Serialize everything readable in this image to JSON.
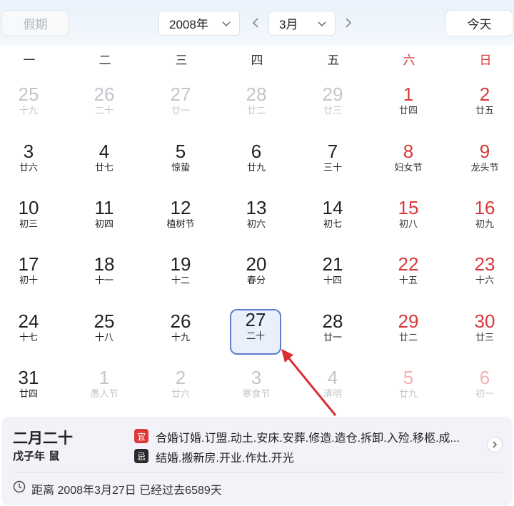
{
  "header": {
    "holiday_label": "假期",
    "year_value": "2008年",
    "month_value": "3月",
    "today_label": "今天"
  },
  "weekdays": [
    "一",
    "二",
    "三",
    "四",
    "五",
    "六",
    "日"
  ],
  "days": [
    {
      "num": "25",
      "lunar": "十九",
      "style": "dim"
    },
    {
      "num": "26",
      "lunar": "二十",
      "style": "dim"
    },
    {
      "num": "27",
      "lunar": "廿一",
      "style": "dim"
    },
    {
      "num": "28",
      "lunar": "廿二",
      "style": "dim"
    },
    {
      "num": "29",
      "lunar": "廿三",
      "style": "dim"
    },
    {
      "num": "1",
      "lunar": "廿四",
      "style": "red"
    },
    {
      "num": "2",
      "lunar": "廿五",
      "style": "red"
    },
    {
      "num": "3",
      "lunar": "廿六",
      "style": "normal"
    },
    {
      "num": "4",
      "lunar": "廿七",
      "style": "normal"
    },
    {
      "num": "5",
      "lunar": "惊蛰",
      "style": "normal"
    },
    {
      "num": "6",
      "lunar": "廿九",
      "style": "normal"
    },
    {
      "num": "7",
      "lunar": "三十",
      "style": "normal"
    },
    {
      "num": "8",
      "lunar": "妇女节",
      "style": "red"
    },
    {
      "num": "9",
      "lunar": "龙头节",
      "style": "red"
    },
    {
      "num": "10",
      "lunar": "初三",
      "style": "normal"
    },
    {
      "num": "11",
      "lunar": "初四",
      "style": "normal"
    },
    {
      "num": "12",
      "lunar": "植树节",
      "style": "normal"
    },
    {
      "num": "13",
      "lunar": "初六",
      "style": "normal"
    },
    {
      "num": "14",
      "lunar": "初七",
      "style": "normal"
    },
    {
      "num": "15",
      "lunar": "初八",
      "style": "red"
    },
    {
      "num": "16",
      "lunar": "初九",
      "style": "red"
    },
    {
      "num": "17",
      "lunar": "初十",
      "style": "normal"
    },
    {
      "num": "18",
      "lunar": "十一",
      "style": "normal"
    },
    {
      "num": "19",
      "lunar": "十二",
      "style": "normal"
    },
    {
      "num": "20",
      "lunar": "春分",
      "style": "normal"
    },
    {
      "num": "21",
      "lunar": "十四",
      "style": "normal"
    },
    {
      "num": "22",
      "lunar": "十五",
      "style": "red"
    },
    {
      "num": "23",
      "lunar": "十六",
      "style": "red"
    },
    {
      "num": "24",
      "lunar": "十七",
      "style": "normal"
    },
    {
      "num": "25",
      "lunar": "十八",
      "style": "normal"
    },
    {
      "num": "26",
      "lunar": "十九",
      "style": "normal"
    },
    {
      "num": "27",
      "lunar": "二十",
      "style": "selected"
    },
    {
      "num": "28",
      "lunar": "廿一",
      "style": "normal"
    },
    {
      "num": "29",
      "lunar": "廿二",
      "style": "red"
    },
    {
      "num": "30",
      "lunar": "廿三",
      "style": "red"
    },
    {
      "num": "31",
      "lunar": "廿四",
      "style": "normal"
    },
    {
      "num": "1",
      "lunar": "愚人节",
      "style": "dim"
    },
    {
      "num": "2",
      "lunar": "廿六",
      "style": "dim"
    },
    {
      "num": "3",
      "lunar": "寒食节",
      "style": "dim"
    },
    {
      "num": "4",
      "lunar": "清明",
      "style": "dim"
    },
    {
      "num": "5",
      "lunar": "廿九",
      "style": "dimred"
    },
    {
      "num": "6",
      "lunar": "初一",
      "style": "dimred"
    }
  ],
  "info": {
    "lunar_date": "二月二十",
    "ganzhi": "戊子年 鼠",
    "yi_tag": "宜",
    "yi_text": "合婚订婚.订盟.动土.安床.安葬.修造.造仓.拆卸.入殓.移柩.成...",
    "ji_tag": "忌",
    "ji_text": "结婚.搬新房.开业.作灶.开光",
    "distance": "距离 2008年3月27日 已经过去6589天"
  },
  "colors": {
    "weekend_red": "#d9383a",
    "selected_border": "#5d7fd0",
    "selected_bg": "#eaf0fb",
    "yi_badge": "#e0383a",
    "ji_badge": "#2a2a2a",
    "annotation_arrow": "#d93036"
  }
}
